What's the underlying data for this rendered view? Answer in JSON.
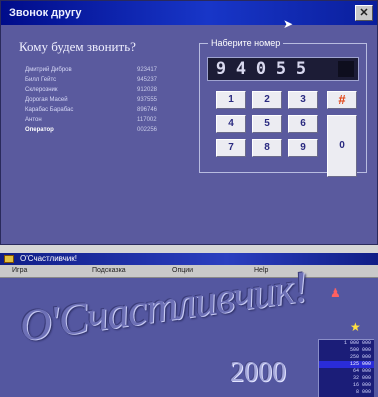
{
  "dial_window": {
    "title": "Звонок другу",
    "close_label": "✕",
    "question": "Кому будем звонить?",
    "contacts": [
      {
        "name": "Дмитрий Дибров",
        "number": "923417"
      },
      {
        "name": "Билл Гейтс",
        "number": "945237"
      },
      {
        "name": "Склерозник",
        "number": "912028"
      },
      {
        "name": "Дорогая Масей",
        "number": "937555"
      },
      {
        "name": "Карабас Барабас",
        "number": "896746"
      },
      {
        "name": "Антон",
        "number": "117002"
      },
      {
        "name": "Оператор",
        "number": "002256"
      }
    ],
    "selected_contact": "Оператор",
    "dial_panel_title": "Наберите номер",
    "display_digits": [
      "9",
      "4",
      "0",
      "5",
      "5"
    ],
    "keypad": {
      "k1": "1",
      "k2": "2",
      "k3": "3",
      "k4": "4",
      "k5": "5",
      "k6": "6",
      "k7": "7",
      "k8": "8",
      "k9": "9",
      "hash": "#",
      "k0": "0"
    },
    "cursor_icon": "arrow-cursor"
  },
  "game_window": {
    "title": "О'Счастливчик!",
    "menu": [
      "Игра",
      "Подсказка",
      "Опции",
      "Help"
    ],
    "logo_main": "О'Счастливчик!",
    "logo_year": "2000",
    "prize_ladder": [
      "1 000 000",
      "500 000",
      "250 000",
      "125 000",
      "64 000",
      "32 000",
      "16 000",
      "8 000"
    ],
    "prize_highlight_index": 3
  },
  "colors": {
    "window_bg": "#5a5a9e",
    "title_bar": "#1836c8",
    "key_face": "#ececf2",
    "hash_key": "#e04010",
    "prize_highlight": "#2a2cd8"
  }
}
